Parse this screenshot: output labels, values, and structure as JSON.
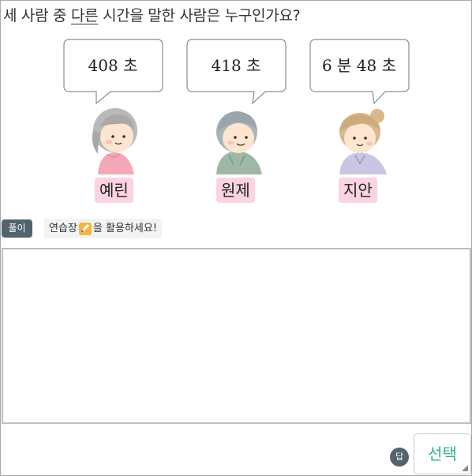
{
  "question": {
    "before": "세 사람 중 ",
    "underlined": "다른",
    "after": " 시간을 말한 사람은 누구인가요?"
  },
  "people": [
    {
      "name": "예린",
      "speech": "408 초"
    },
    {
      "name": "원제",
      "speech": "418 초"
    },
    {
      "name": "지안",
      "speech": "6 분 48 초"
    }
  ],
  "solve": {
    "badge_label": "풀이",
    "hint_before": "연습장",
    "hint_after": "을 활용하세요!",
    "hint_icon": "pencil-note-icon"
  },
  "answer": {
    "badge_label": "답",
    "select_label": "선택"
  },
  "colors": {
    "name_tag_bg": "#fbd3e3",
    "badge_bg": "#52646d",
    "select_text": "#33b38a"
  }
}
